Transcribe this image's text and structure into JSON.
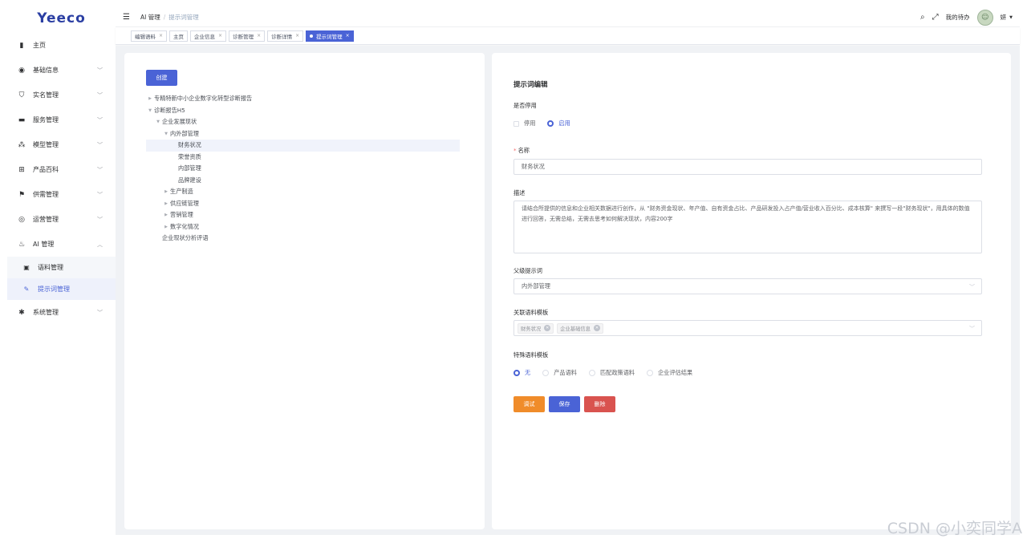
{
  "app": {
    "logo": "Yeeco"
  },
  "sidebar": {
    "items": [
      {
        "label": "主页",
        "icon": "bar-chart-icon",
        "glyph": "▮"
      },
      {
        "label": "基础信息",
        "icon": "globe-icon",
        "glyph": "◉"
      },
      {
        "label": "实名管理",
        "icon": "shield-icon",
        "glyph": "⛉"
      },
      {
        "label": "服务管理",
        "icon": "card-icon",
        "glyph": "▬"
      },
      {
        "label": "模型管理",
        "icon": "hierarchy-icon",
        "glyph": "⁂"
      },
      {
        "label": "产品百科",
        "icon": "cart-icon",
        "glyph": "⊞"
      },
      {
        "label": "供需管理",
        "icon": "flag-icon",
        "glyph": "⚑"
      },
      {
        "label": "运营管理",
        "icon": "settings-circle-icon",
        "glyph": "◎"
      },
      {
        "label": "AI 管理",
        "icon": "ai-icon",
        "glyph": "♨"
      },
      {
        "label": "系统管理",
        "icon": "gear-icon",
        "glyph": "✱"
      }
    ],
    "sub_items": [
      {
        "label": "语料管理",
        "icon": "book-icon",
        "glyph": "▣"
      },
      {
        "label": "提示词管理",
        "icon": "wand-icon",
        "glyph": "✎"
      }
    ]
  },
  "header": {
    "breadcrumb": [
      "AI 管理",
      "提示词管理"
    ],
    "todo": "我的待办",
    "user": "妍",
    "avatar_glyph": "☺"
  },
  "tags": [
    {
      "label": "编辑语料"
    },
    {
      "label": "主页"
    },
    {
      "label": "企业信息"
    },
    {
      "label": "诊断管理"
    },
    {
      "label": "诊断详情"
    },
    {
      "label": "提示词管理"
    }
  ],
  "tree": {
    "create_label": "创建",
    "nodes": [
      {
        "label": "专精特新中小企业数字化转型诊断报告",
        "arrow": "▶"
      },
      {
        "label": "诊断报告H5",
        "arrow": "▼"
      },
      {
        "label": "企业发展现状",
        "arrow": "▼"
      },
      {
        "label": "内外部管理",
        "arrow": "▼"
      },
      {
        "label": "财务状况",
        "arrow": ""
      },
      {
        "label": "荣誉资质",
        "arrow": ""
      },
      {
        "label": "内部管理",
        "arrow": ""
      },
      {
        "label": "品牌建设",
        "arrow": ""
      },
      {
        "label": "生产制造",
        "arrow": "▶"
      },
      {
        "label": "供应链管理",
        "arrow": "▶"
      },
      {
        "label": "营销管理",
        "arrow": "▶"
      },
      {
        "label": "数字化情况",
        "arrow": "▶"
      },
      {
        "label": "企业现状分析评语",
        "arrow": ""
      }
    ]
  },
  "form": {
    "title": "提示词编辑",
    "disable_label": "是否停用",
    "disable_options": [
      "停用",
      "启用"
    ],
    "name_label": "名称",
    "name_value": "财务状况",
    "desc_label": "描述",
    "desc_value": "请结合所提供的信息和企业相关数据进行创作，从 \"财务资金现状、年产值、自有资金占比、产品研发投入占产值/营业收入百分比、成本核算\" 来撰写一段\"财务现状\"，用具体的数值进行回答，无需总结，无需去思考如何解决现状，内容200字",
    "parent_label": "父级提示词",
    "parent_value": "内外部管理",
    "templates_label": "关联语料模板",
    "templates": [
      "财务状况",
      "企业基础信息"
    ],
    "special_label": "特殊语料模板",
    "special_options": [
      "无",
      "产品语料",
      "匹配政策语料",
      "企业评估结果"
    ],
    "buttons": {
      "debug": "调试",
      "save": "保存",
      "delete": "删除"
    }
  },
  "watermark": "CSDN @小奕同学A"
}
